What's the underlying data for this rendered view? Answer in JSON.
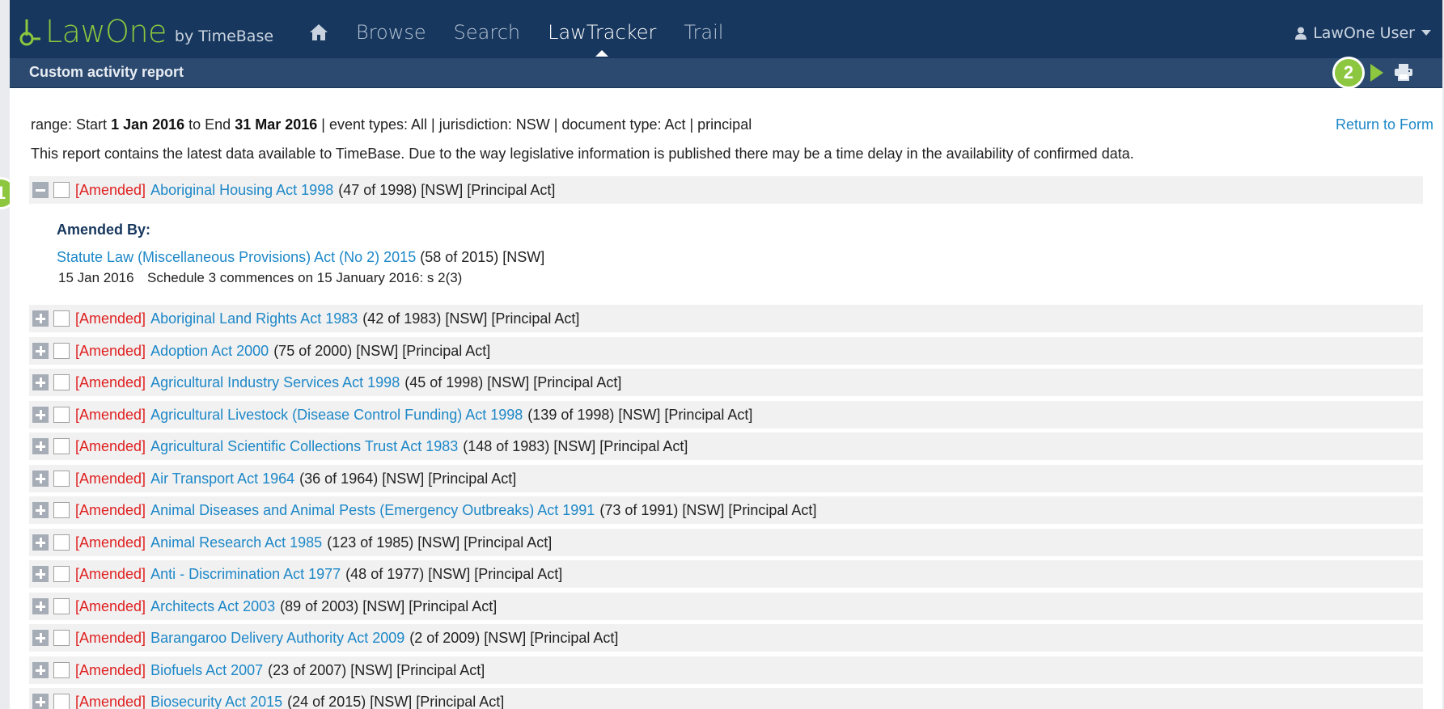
{
  "app": {
    "brand": "LawOne",
    "brand_by": "by TimeBase",
    "brand_color": "#8dc63f",
    "nav_bg": "#17375e"
  },
  "nav": {
    "home_icon": "home-icon",
    "items": [
      {
        "label": "Browse",
        "active": false
      },
      {
        "label": "Search",
        "active": false
      },
      {
        "label": "LawTracker",
        "active": true
      },
      {
        "label": "Trail",
        "active": false
      }
    ],
    "user_label": "LawOne User"
  },
  "subheader": {
    "title": "Custom activity report",
    "callout_2": "2",
    "print_icon": "print-icon"
  },
  "report": {
    "range_prefix": "range: Start ",
    "start": "1 Jan 2016",
    "range_mid": " to End ",
    "end": "31 Mar 2016",
    "range_suffix": " | event types: All | jurisdiction: NSW | document type: Act | principal",
    "return_label": "Return to Form",
    "info": "This report contains the latest data available to TimeBase. Due to the way legislative information is published there may be a time delay in the availability of confirmed data."
  },
  "callout_1": "1",
  "expanded_item": {
    "status": "[Amended]",
    "title": "Aboriginal Housing Act 1998",
    "meta": "(47 of 1998) [NSW] [Principal Act]",
    "amended_by_label": "Amended By:",
    "amending_title": "Statute Law (Miscellaneous Provisions) Act (No 2) 2015",
    "amending_meta": "(58 of 2015) [NSW]",
    "date": "15 Jan 2016",
    "description": "Schedule 3 commences on 15 January 2016: s 2(3)"
  },
  "items": [
    {
      "status": "[Amended]",
      "title": "Aboriginal Land Rights Act 1983",
      "meta": "(42 of 1983) [NSW] [Principal Act]"
    },
    {
      "status": "[Amended]",
      "title": "Adoption Act 2000",
      "meta": "(75 of 2000) [NSW] [Principal Act]"
    },
    {
      "status": "[Amended]",
      "title": "Agricultural Industry Services Act 1998",
      "meta": "(45 of 1998) [NSW] [Principal Act]"
    },
    {
      "status": "[Amended]",
      "title": "Agricultural Livestock (Disease Control Funding) Act 1998",
      "meta": "(139 of 1998) [NSW] [Principal Act]"
    },
    {
      "status": "[Amended]",
      "title": "Agricultural Scientific Collections Trust Act 1983",
      "meta": "(148 of 1983) [NSW] [Principal Act]"
    },
    {
      "status": "[Amended]",
      "title": "Air Transport Act 1964",
      "meta": "(36 of 1964) [NSW] [Principal Act]"
    },
    {
      "status": "[Amended]",
      "title": "Animal Diseases and Animal Pests (Emergency Outbreaks) Act 1991",
      "meta": "(73 of 1991) [NSW] [Principal Act]"
    },
    {
      "status": "[Amended]",
      "title": "Animal Research Act 1985",
      "meta": "(123 of 1985) [NSW] [Principal Act]"
    },
    {
      "status": "[Amended]",
      "title": "Anti - Discrimination Act 1977",
      "meta": "(48 of 1977) [NSW] [Principal Act]"
    },
    {
      "status": "[Amended]",
      "title": "Architects Act 2003",
      "meta": "(89 of 2003) [NSW] [Principal Act]"
    },
    {
      "status": "[Amended]",
      "title": "Barangaroo Delivery Authority Act 2009",
      "meta": "(2 of 2009) [NSW] [Principal Act]"
    },
    {
      "status": "[Amended]",
      "title": "Biofuels Act 2007",
      "meta": "(23 of 2007) [NSW] [Principal Act]"
    },
    {
      "status": "[Amended]",
      "title": "Biosecurity Act 2015",
      "meta": "(24 of 2015) [NSW] [Principal Act]"
    }
  ]
}
